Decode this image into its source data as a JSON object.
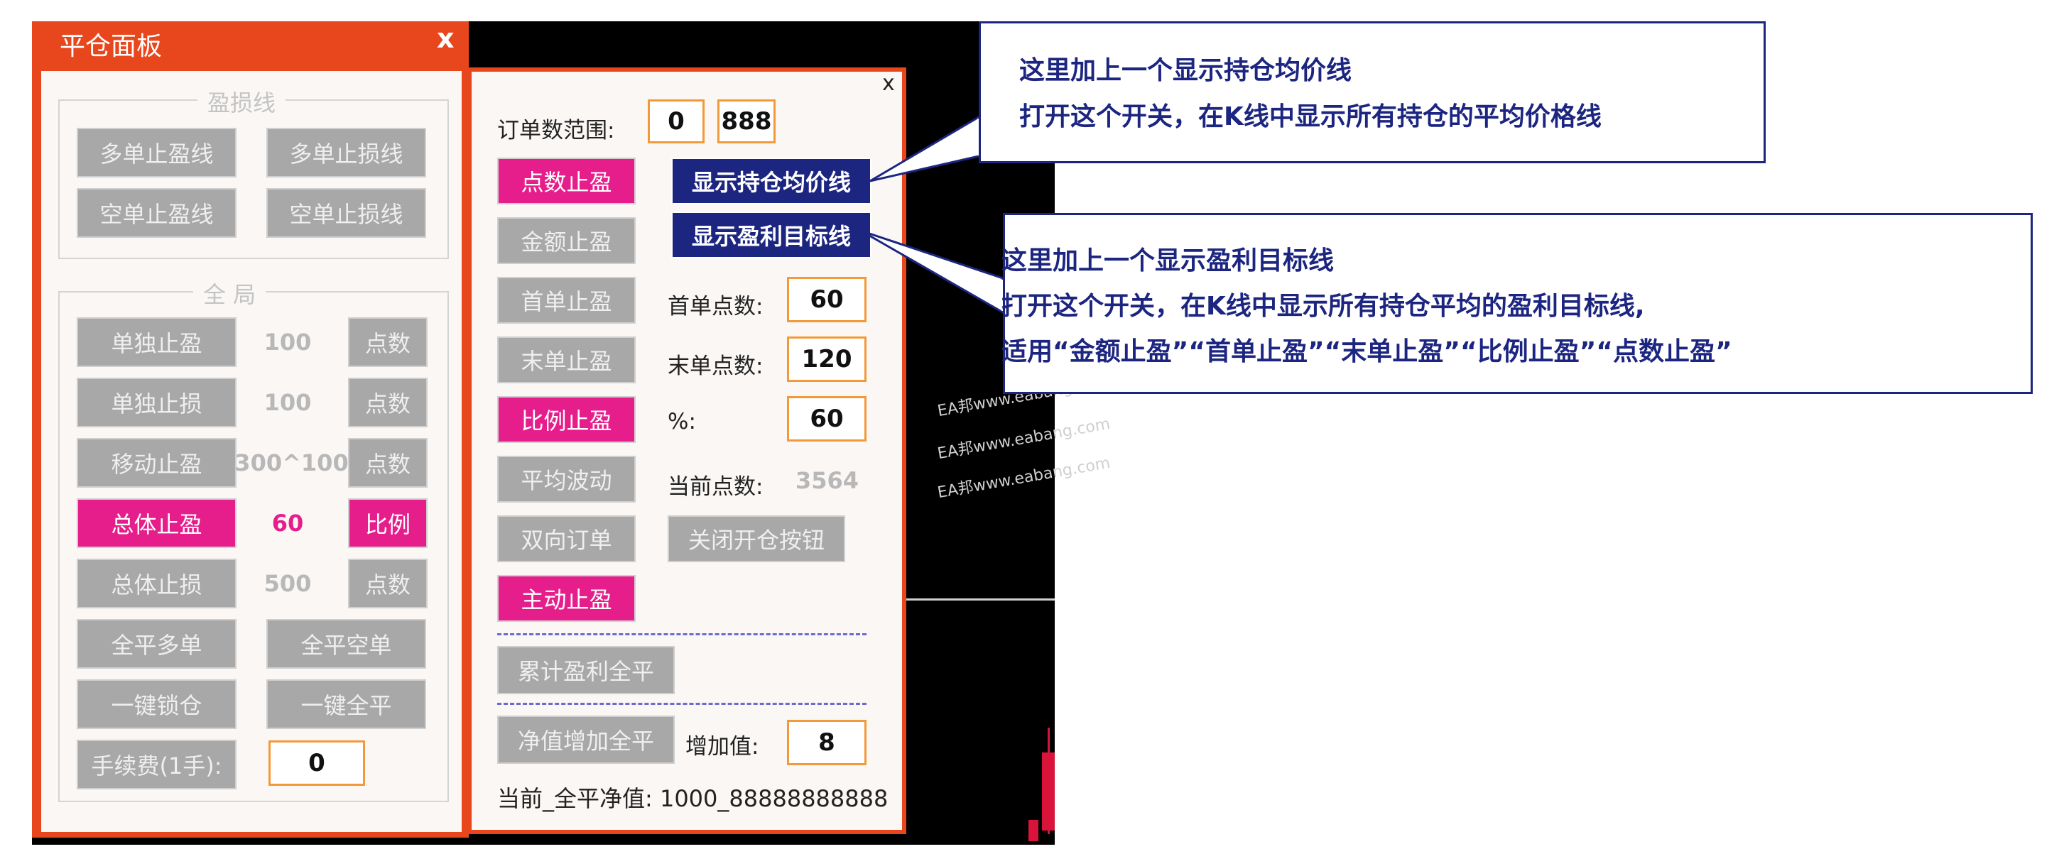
{
  "left_panel": {
    "title": "平仓面板",
    "close": "x",
    "group_profit_loss": {
      "label": "盈损线",
      "buttons": [
        "多单止盈线",
        "多单止损线",
        "空单止盈线",
        "空单止损线"
      ]
    },
    "group_global": {
      "label": "全 局",
      "rows": [
        {
          "button": "单独止盈",
          "value": "100",
          "unit": "点数",
          "active": false
        },
        {
          "button": "单独止损",
          "value": "100",
          "unit": "点数",
          "active": false
        },
        {
          "button": "移动止盈",
          "value": "300^100",
          "unit": "点数",
          "active": false
        },
        {
          "button": "总体止盈",
          "value": "60",
          "unit": "比例",
          "active": true
        },
        {
          "button": "总体止损",
          "value": "500",
          "unit": "点数",
          "active": false
        }
      ],
      "close_long": "全平多单",
      "close_short": "全平空单",
      "lock": "一键锁仓",
      "close_all": "一键全平",
      "fee_label": "手续费(1手):",
      "fee_value": "0"
    }
  },
  "right_panel": {
    "close": "x",
    "order_range_label": "订单数范围:",
    "order_range_min": "0",
    "order_range_max": "888",
    "buttons": {
      "points_tp": "点数止盈",
      "amount_tp": "金额止盈",
      "first_tp": "首单止盈",
      "last_tp": "末单止盈",
      "ratio_tp": "比例止盈",
      "avg_wave": "平均波动",
      "two_way": "双向订单",
      "active_tp": "主动止盈",
      "show_avg_line": "显示持仓均价线",
      "show_target_line": "显示盈利目标线",
      "close_open_btn": "关闭开仓按钮",
      "cum_close_all": "累计盈利全平",
      "equity_close_all": "净值增加全平"
    },
    "first_points_label": "首单点数:",
    "first_points_value": "60",
    "last_points_label": "末单点数:",
    "last_points_value": "120",
    "percent_label": "%:",
    "percent_value": "60",
    "current_points_label": "当前点数:",
    "current_points_value": "3564",
    "increase_label": "增加值:",
    "increase_value": "8",
    "current_equity": "当前_全平净值: 1000_88888888888"
  },
  "watermark": [
    "EA邦www.eabang.com",
    "EA邦www.eabang.com",
    "EA邦www.eabang.com"
  ],
  "callout1": {
    "line1": "这里加上一个显示持仓均价线",
    "line2": "打开这个开关，在K线中显示所有持仓的平均价格线"
  },
  "callout2": {
    "line1": "这里加上一个显示盈利目标线",
    "line2": "打开这个开关，在K线中显示所有持仓平均的盈利目标线,",
    "line3": "适用“金额止盈”“首单止盈”“末单止盈”“比例止盈”“点数止盈”"
  },
  "colors": {
    "panel_border": "#e8461c",
    "active_button": "#e61e8c",
    "navy": "#1c2580",
    "input_border": "#f29a3a",
    "candle": "#d9143a"
  }
}
